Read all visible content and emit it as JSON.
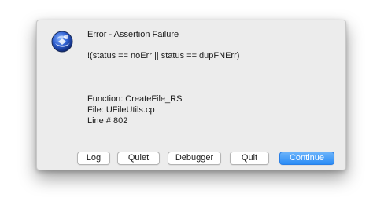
{
  "dialog": {
    "title": "Error - Assertion Failure",
    "assertion": "!(status == noErr || status == dupFNErr)",
    "function_line": "Function: CreateFile_RS",
    "file_line": "File: UFileUtils.cp",
    "line_line": "Line # 802",
    "app_icon": "app-globe-icon",
    "accent_color": "#3a8ef6"
  },
  "buttons": {
    "log": "Log",
    "quiet": "Quiet",
    "debugger": "Debugger",
    "quit": "Quit",
    "continue": "Continue"
  }
}
